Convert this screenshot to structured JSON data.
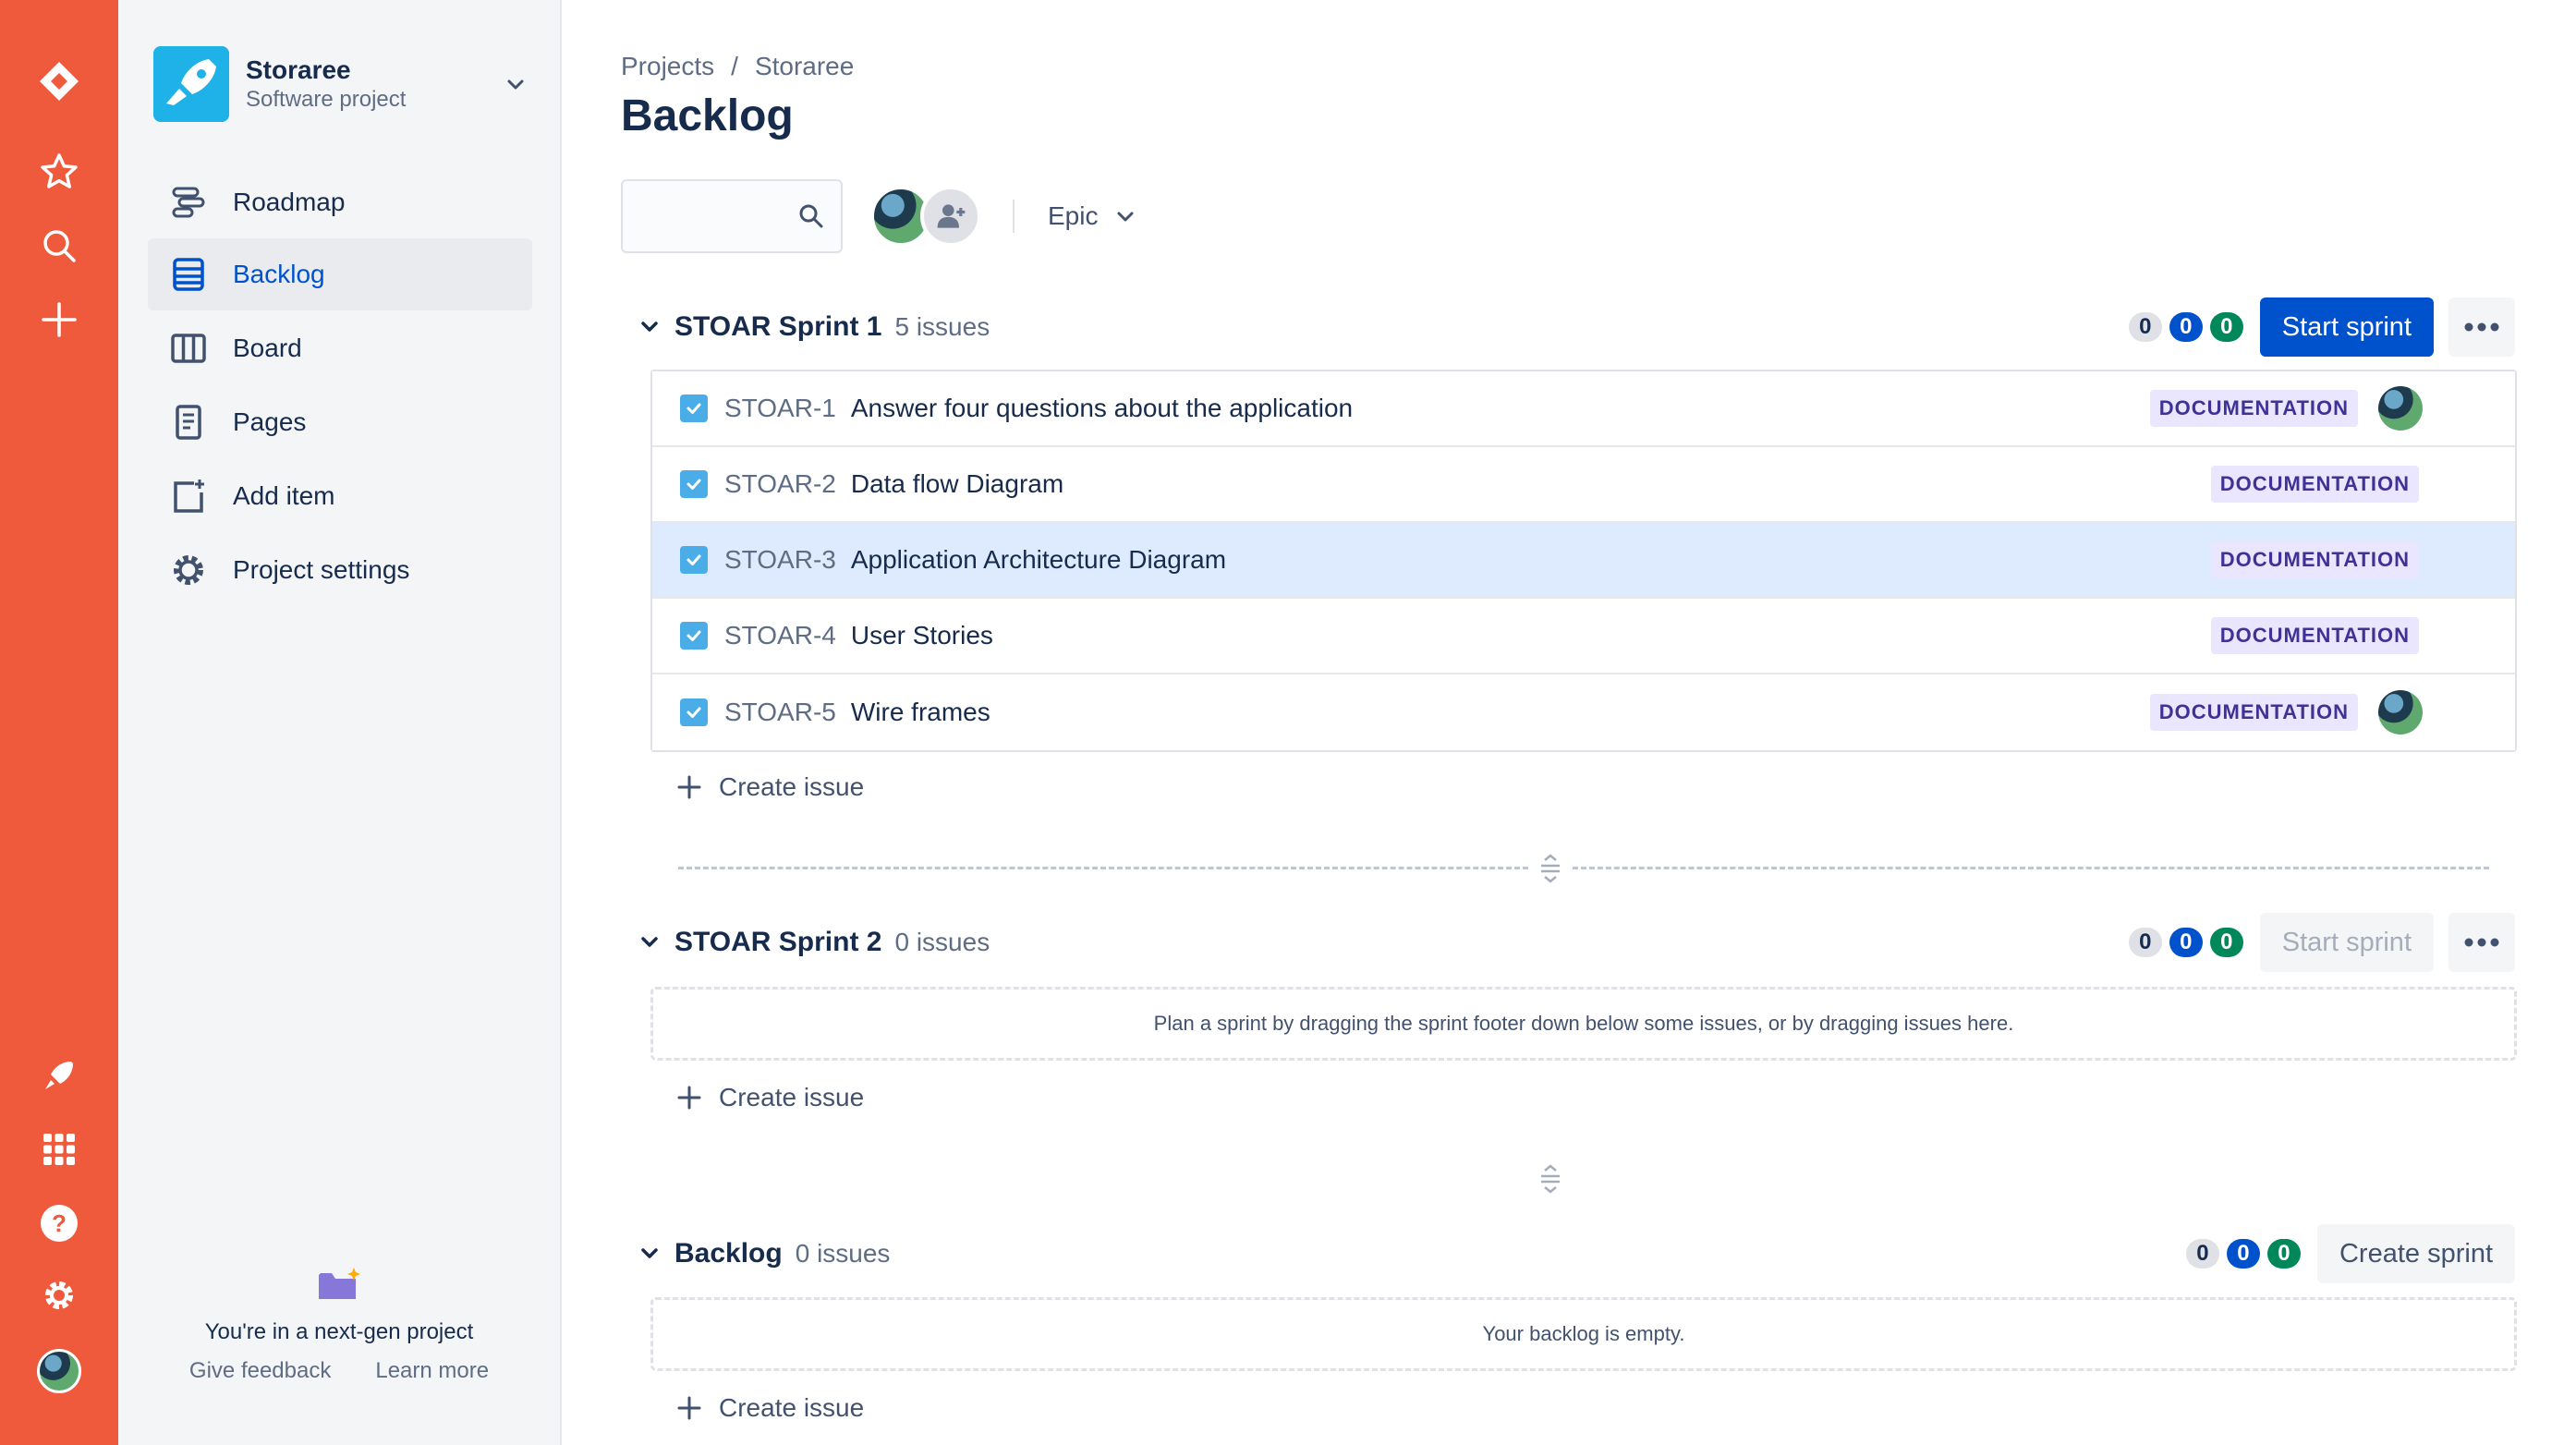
{
  "project": {
    "name": "Storaree",
    "type": "Software project"
  },
  "sidebar": {
    "items": [
      {
        "label": "Roadmap",
        "icon": "roadmap-icon"
      },
      {
        "label": "Backlog",
        "icon": "backlog-icon",
        "active": true
      },
      {
        "label": "Board",
        "icon": "board-icon"
      },
      {
        "label": "Pages",
        "icon": "pages-icon"
      },
      {
        "label": "Add item",
        "icon": "add-item-icon"
      },
      {
        "label": "Project settings",
        "icon": "gear-icon"
      }
    ],
    "footer": {
      "text": "You're in a next-gen project",
      "feedback": "Give feedback",
      "learn": "Learn more"
    }
  },
  "breadcrumb": {
    "root": "Projects",
    "separator": "/",
    "current": "Storaree"
  },
  "page": {
    "title": "Backlog"
  },
  "toolbar": {
    "search_placeholder": "",
    "epic_label": "Epic"
  },
  "sprints": [
    {
      "name": "STOAR Sprint 1",
      "count": "5 issues",
      "pills": [
        "0",
        "0",
        "0"
      ],
      "button": "Start sprint",
      "issues": [
        {
          "key": "STOAR-1",
          "summary": "Answer four questions about the application",
          "label": "DOCUMENTATION",
          "has_avatar": true
        },
        {
          "key": "STOAR-2",
          "summary": "Data flow Diagram",
          "label": "DOCUMENTATION",
          "has_avatar": false
        },
        {
          "key": "STOAR-3",
          "summary": "Application Architecture Diagram",
          "label": "DOCUMENTATION",
          "has_avatar": false,
          "selected": true
        },
        {
          "key": "STOAR-4",
          "summary": "User Stories",
          "label": "DOCUMENTATION",
          "has_avatar": false
        },
        {
          "key": "STOAR-5",
          "summary": "Wire frames",
          "label": "DOCUMENTATION",
          "has_avatar": true
        }
      ],
      "create": "Create issue"
    },
    {
      "name": "STOAR Sprint 2",
      "count": "0 issues",
      "pills": [
        "0",
        "0",
        "0"
      ],
      "button": "Start sprint",
      "empty_text": "Plan a sprint by dragging the sprint footer down below some issues, or by dragging issues here.",
      "create": "Create issue"
    }
  ],
  "backlog": {
    "name": "Backlog",
    "count": "0 issues",
    "pills": [
      "0",
      "0",
      "0"
    ],
    "button": "Create sprint",
    "empty_text": "Your backlog is empty.",
    "create": "Create issue"
  },
  "colors": {
    "rail": "#F05A3C",
    "primary": "#0052CC",
    "label_bg": "#EAE6FF",
    "label_text": "#403294",
    "selected_row": "#DEEBFF"
  }
}
